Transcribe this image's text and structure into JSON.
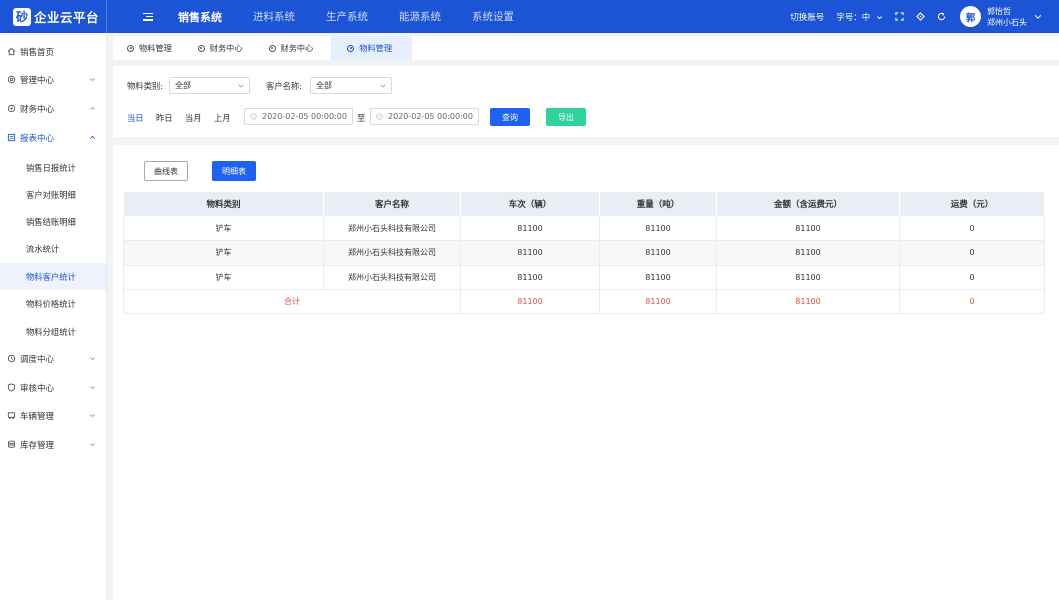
{
  "brand": {
    "logo_text": "砂",
    "name": "企业云平台"
  },
  "topnav": [
    {
      "label": "销售系统",
      "active": true
    },
    {
      "label": "进料系统",
      "active": false
    },
    {
      "label": "生产系统",
      "active": false
    },
    {
      "label": "能源系统",
      "active": false
    },
    {
      "label": "系统设置",
      "active": false
    }
  ],
  "header": {
    "switch_account": "切换账号",
    "font_size": "字号：中",
    "avatar_text": "郭",
    "user_name": "郭怡哲",
    "company": "郑州小石头",
    "icons": [
      "fullscreen-icon",
      "tag-icon",
      "refresh-icon",
      "chevron-down-icon"
    ]
  },
  "sidebar": {
    "items": [
      {
        "label": "销售首页",
        "icon": "home-icon"
      },
      {
        "label": "管理中心",
        "icon": "gear-icon"
      },
      {
        "label": "财务中心",
        "icon": "finance-icon"
      },
      {
        "label": "报表中心",
        "icon": "report-icon"
      },
      {
        "label": "调度中心",
        "icon": "dispatch-icon"
      },
      {
        "label": "审核中心",
        "icon": "shield-icon"
      },
      {
        "label": "车辆管理",
        "icon": "truck-icon"
      },
      {
        "label": "库存管理",
        "icon": "database-icon"
      }
    ],
    "sub_items": [
      {
        "label": "销售日报统计"
      },
      {
        "label": "客户对账明细"
      },
      {
        "label": "销售结账明细"
      },
      {
        "label": "流水统计"
      },
      {
        "label": "物料客户统计"
      },
      {
        "label": "物料价格统计"
      },
      {
        "label": "物料分组统计"
      }
    ]
  },
  "tabs": [
    {
      "label": "物料管理"
    },
    {
      "label": "财务中心"
    },
    {
      "label": "财务中心"
    },
    {
      "label": "物料管理"
    }
  ],
  "filter": {
    "material_label": "物料类别:",
    "material_value": "全部",
    "customer_label": "客户名称:",
    "customer_value": "全部",
    "quick_dates": [
      "当日",
      "昨日",
      "当月",
      "上月"
    ],
    "start_date": "2020-02-05  00:00:00",
    "to_label": "至",
    "end_date": "2020-02-05  00:00:00",
    "query_button": "查询",
    "export_button": "导出"
  },
  "view_toggle": {
    "curve": "曲线表",
    "detail": "明细表"
  },
  "table": {
    "headers": [
      "物料类别",
      "客户名称",
      "车次（辆）",
      "重量（吨）",
      "金额（含运费元）",
      "运费（元）"
    ],
    "rows": [
      [
        "铲车",
        "郑州小石头科技有限公司",
        "81100",
        "81100",
        "81100",
        "0"
      ],
      [
        "铲车",
        "郑州小石头科技有限公司",
        "81100",
        "81100",
        "81100",
        "0"
      ],
      [
        "铲车",
        "郑州小石头科技有限公司",
        "81100",
        "81100",
        "81100",
        "0"
      ]
    ],
    "total": [
      "合计",
      "81100",
      "81100",
      "81100",
      "0"
    ]
  },
  "colors": {
    "primary": "#1c54d6",
    "button_blue": "#1f62f2",
    "export_green": "#2fd39e",
    "total_red": "#e64a3c"
  }
}
